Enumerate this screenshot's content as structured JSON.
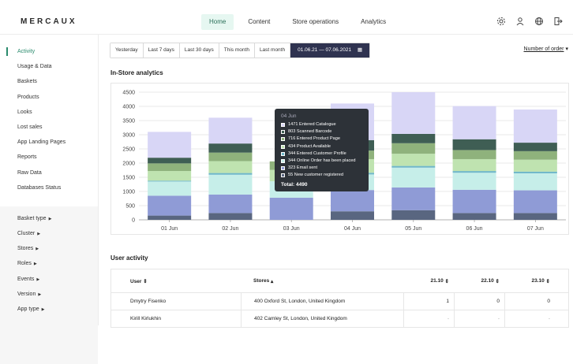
{
  "header": {
    "logo": "MERCAUX",
    "nav": [
      "Home",
      "Content",
      "Store operations",
      "Analytics"
    ],
    "icons": [
      "settings-icon",
      "user-icon",
      "globe-icon",
      "logout-icon"
    ]
  },
  "sidebar": {
    "items": [
      "Activity",
      "Usage & Data",
      "Baskets",
      "Products",
      "Looks",
      "Lost sales",
      "App Landing Pages",
      "Reports",
      "Raw Data",
      "Databases Status"
    ],
    "filters": [
      "Basket  type",
      "Cluster",
      "Stores",
      "Roles",
      "Events",
      "Version",
      "App type"
    ]
  },
  "datebar": {
    "buttons": [
      "Yesterday",
      "Last 7 days",
      "Last 30 days",
      "This month",
      "Last month"
    ],
    "range": "01.06.21 — 07.06.2021"
  },
  "metric_select": "Number of order",
  "analytics_title": "In-Store analytics",
  "colors": {
    "accent": "#2a8b6d",
    "series": [
      "#596680",
      "#8f9bd6",
      "#c6eee9",
      "#6fb7c9",
      "#bfe3b0",
      "#8fb27c",
      "#3f5e54",
      "#d8d6f6"
    ]
  },
  "chart_data": {
    "type": "bar",
    "stacked": true,
    "categories": [
      "01 Jun",
      "02 Jun",
      "03 Jun",
      "04 Jun",
      "05 Jun",
      "06 Jun",
      "07 Jun"
    ],
    "ylim": [
      0,
      4500
    ],
    "yticks": [
      0,
      500,
      1000,
      1500,
      2000,
      2500,
      3000,
      3500,
      4000,
      4500
    ],
    "series": [
      {
        "name": "323 Email sent",
        "values": [
          150,
          240,
          0,
          300,
          340,
          240,
          240
        ]
      },
      {
        "name": "344 Online Order has been placed",
        "values": [
          700,
          650,
          780,
          750,
          800,
          820,
          800
        ]
      },
      {
        "name": "344 Entered Customer Profile",
        "values": [
          500,
          700,
          580,
          550,
          700,
          600,
          600
        ]
      },
      {
        "name": "434 Product Available",
        "values": [
          30,
          60,
          0,
          60,
          60,
          60,
          60
        ]
      },
      {
        "name": "716 Entered Product Page",
        "values": [
          340,
          420,
          400,
          480,
          430,
          420,
          420
        ]
      },
      {
        "name": "803 Scanned Barcode",
        "values": [
          270,
          300,
          300,
          300,
          370,
          320,
          300
        ]
      },
      {
        "name": "55 New customer registered",
        "values": [
          200,
          320,
          0,
          370,
          330,
          380,
          300
        ]
      },
      {
        "name": "1471 Entered Catalogue",
        "values": [
          910,
          910,
          0,
          1290,
          1470,
          1170,
          1170
        ]
      }
    ]
  },
  "tooltip": {
    "date": "04 Jun",
    "rows": [
      {
        "label": "1471 Entered Catalogue",
        "color": "#d8d6f6"
      },
      {
        "label": "803 Scanned Barcode",
        "color": "#3f5e54"
      },
      {
        "label": "716 Entered Product Page",
        "color": "#8fb27c"
      },
      {
        "label": "434 Product Available",
        "color": "#bfe3b0"
      },
      {
        "label": "344 Entered Customer Profile",
        "color": "#6fb7c9"
      },
      {
        "label": "344 Online Order has been placed",
        "color": "#c6eee9"
      },
      {
        "label": "323 Email sent",
        "color": "#8f9bd6"
      },
      {
        "label": "55 New customer registered",
        "color": "#596680"
      }
    ],
    "total": "Total: 4490"
  },
  "activity_title": "User activity",
  "table": {
    "headers": [
      "User",
      "Stores",
      "21.10",
      "22.10",
      "23.10"
    ],
    "rows": [
      [
        "Dmytry Fisenko",
        "400 Oxford St, London, United Kingdom",
        "1",
        "0",
        "0"
      ],
      [
        "Kirill Kirlukhin",
        "402 Camley St, London, United Kingdom",
        "-",
        "-",
        "-"
      ]
    ]
  }
}
